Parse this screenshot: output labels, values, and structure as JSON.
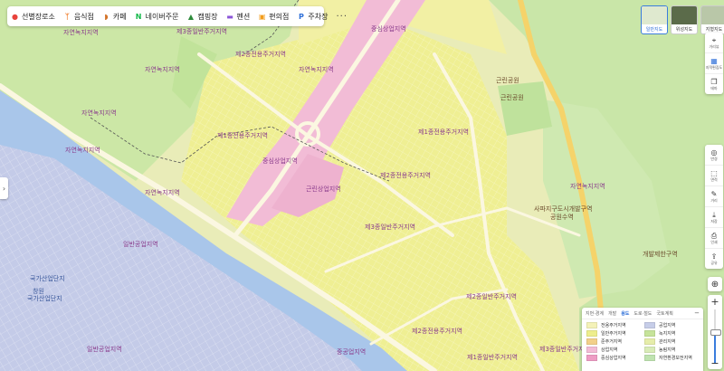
{
  "categories": [
    {
      "label": "선별장로소",
      "icon": "pin-icon",
      "color": "#e8433c"
    },
    {
      "label": "음식점",
      "icon": "fork-knife-icon",
      "color": "#f07d2b"
    },
    {
      "label": "카페",
      "icon": "cup-icon",
      "color": "#d3742a"
    },
    {
      "label": "네이버주문",
      "icon": "naver-n-icon",
      "color": "#14b84a"
    },
    {
      "label": "캠핑장",
      "icon": "tent-icon",
      "color": "#2c8a3a"
    },
    {
      "label": "펜션",
      "icon": "bed-icon",
      "color": "#8b55d8"
    },
    {
      "label": "편의점",
      "icon": "store-icon",
      "color": "#f29d1c"
    },
    {
      "label": "주차장",
      "icon": "parking-icon",
      "color": "#2e6fd8"
    }
  ],
  "more_label": "···",
  "map_types": [
    {
      "label": "일반지도",
      "active": true
    },
    {
      "label": "위성지도",
      "active": false
    },
    {
      "label": "지형지도",
      "active": false
    }
  ],
  "toolbar": [
    {
      "icon": "pin-icon",
      "label": "거리뷰",
      "glyph": "⌖"
    },
    {
      "icon": "layer-icon",
      "label": "지적편집도",
      "glyph": "▦",
      "selected": true
    },
    {
      "icon": "copy-icon",
      "label": "테마",
      "glyph": "❐"
    }
  ],
  "toolbar2": [
    {
      "icon": "radius-icon",
      "label": "반경",
      "glyph": "◎"
    },
    {
      "icon": "area-icon",
      "label": "면적",
      "glyph": "⬚"
    },
    {
      "icon": "ruler-icon",
      "label": "거리",
      "glyph": "✎"
    },
    {
      "icon": "save-icon",
      "label": "저장",
      "glyph": "⤓"
    },
    {
      "icon": "print-icon",
      "label": "인쇄",
      "glyph": "⎙"
    },
    {
      "icon": "share-icon",
      "label": "공유",
      "glyph": "⇪"
    }
  ],
  "left_arrow": "›",
  "locate_glyph": "⊕",
  "zoom": {
    "plus": "+",
    "minus": "−",
    "level": 0.6
  },
  "legend": {
    "tabs": [
      "지번·경계",
      "개발",
      "용도",
      "도로·철도",
      "국토계획"
    ],
    "active_tab": 2,
    "close": "−",
    "items": [
      {
        "label": "전용주거지역",
        "color": "#f4f2b8"
      },
      {
        "label": "공업지역",
        "color": "#c6cde8"
      },
      {
        "label": "일반주거지역",
        "color": "#eeee8c"
      },
      {
        "label": "녹지지역",
        "color": "#c6e39a"
      },
      {
        "label": "준주거지역",
        "color": "#f2d08a"
      },
      {
        "label": "관리지역",
        "color": "#e6edaa"
      },
      {
        "label": "상업지역",
        "color": "#f2bcd6"
      },
      {
        "label": "농림지역",
        "color": "#d9ecb8"
      },
      {
        "label": "중심상업지역",
        "color": "#ee9cc4"
      },
      {
        "label": "자연환경보전지역",
        "color": "#bfe3b0"
      }
    ]
  },
  "map_labels": [
    {
      "text": "자연녹지지역",
      "kind": "zone"
    },
    {
      "text": "제3종일반주거지역",
      "kind": "zone"
    },
    {
      "text": "중심상업지역",
      "kind": "zone"
    },
    {
      "text": "제2종전용주거지역",
      "kind": "zone"
    },
    {
      "text": "자연녹지지역",
      "kind": "zone"
    },
    {
      "text": "자연녹지지역",
      "kind": "zone"
    },
    {
      "text": "근린공원",
      "kind": "place"
    },
    {
      "text": "근린공원",
      "kind": "place"
    },
    {
      "text": "자연녹지지역",
      "kind": "zone"
    },
    {
      "text": "제1종전용주거지역",
      "kind": "zone"
    },
    {
      "text": "제1종전용주거지역",
      "kind": "zone"
    },
    {
      "text": "중심상업지역",
      "kind": "zone"
    },
    {
      "text": "근린상업지역",
      "kind": "zone"
    },
    {
      "text": "제2종전용주거지역",
      "kind": "zone"
    },
    {
      "text": "자연녹지지역",
      "kind": "zone"
    },
    {
      "text": "자연녹지지역",
      "kind": "zone"
    },
    {
      "text": "사파지구도시개발구역",
      "kind": "place"
    },
    {
      "text": "공원수역",
      "kind": "place"
    },
    {
      "text": "제3종일반주거지역",
      "kind": "zone"
    },
    {
      "text": "일반공업지역",
      "kind": "zone"
    },
    {
      "text": "개발제한구역",
      "kind": "place"
    },
    {
      "text": "국가산업단지",
      "kind": "zone-blue"
    },
    {
      "text": "창원",
      "kind": "zone-blue"
    },
    {
      "text": "국가산업단지",
      "kind": "zone-blue"
    },
    {
      "text": "제2종일반주거지역",
      "kind": "zone"
    },
    {
      "text": "제2종전용주거지역",
      "kind": "zone"
    },
    {
      "text": "중공업지역",
      "kind": "zone"
    },
    {
      "text": "일반공업지역",
      "kind": "zone"
    },
    {
      "text": "제1종일반주거지역",
      "kind": "zone"
    },
    {
      "text": "제3종일반주거지역",
      "kind": "zone"
    },
    {
      "text": "자연녹지지역",
      "kind": "zone"
    }
  ]
}
